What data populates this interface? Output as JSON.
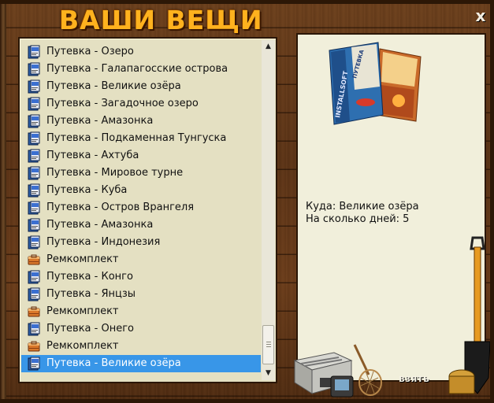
{
  "window": {
    "title": "ВАШИ ВЕЩИ",
    "close_label": "x"
  },
  "inventory": {
    "items": [
      {
        "label": "Путевка - Озеро",
        "icon": "voucher-icon"
      },
      {
        "label": "Путевка - Галапагосские острова",
        "icon": "voucher-icon"
      },
      {
        "label": "Путевка - Великие озёра",
        "icon": "voucher-icon"
      },
      {
        "label": "Путевка - Загадочное озеро",
        "icon": "voucher-icon"
      },
      {
        "label": "Путевка - Амазонка",
        "icon": "voucher-icon"
      },
      {
        "label": "Путевка - Подкаменная Тунгуска",
        "icon": "voucher-icon"
      },
      {
        "label": "Путевка - Ахтуба",
        "icon": "voucher-icon"
      },
      {
        "label": "Путевка - Мировое турне",
        "icon": "voucher-icon"
      },
      {
        "label": "Путевка - Куба",
        "icon": "voucher-icon"
      },
      {
        "label": "Путевка - Остров Врангеля",
        "icon": "voucher-icon"
      },
      {
        "label": "Путевка - Амазонка",
        "icon": "voucher-icon"
      },
      {
        "label": "Путевка - Индонезия",
        "icon": "voucher-icon"
      },
      {
        "label": "Ремкомплект",
        "icon": "repair-kit-icon"
      },
      {
        "label": "Путевка - Конго",
        "icon": "voucher-icon"
      },
      {
        "label": "Путевка - Янцзы",
        "icon": "voucher-icon"
      },
      {
        "label": "Ремкомплект",
        "icon": "repair-kit-icon"
      },
      {
        "label": "Путевка - Онего",
        "icon": "voucher-icon"
      },
      {
        "label": "Ремкомплект",
        "icon": "repair-kit-icon"
      },
      {
        "label": "Путевка - Великие озёра",
        "icon": "voucher-icon"
      }
    ],
    "selected_index": 18
  },
  "details": {
    "line1": "Куда: Великие озёра",
    "line2": "На сколько дней: 5",
    "brochure_brand": "INSTALLSOFT",
    "brochure_title": "ПУТЕВКА"
  },
  "actions": {
    "take_label": "взять"
  },
  "colors": {
    "title": "#ffb21e",
    "selection": "#3896e8",
    "list_bg": "#e4e0c2",
    "info_bg": "#f1efdb"
  }
}
